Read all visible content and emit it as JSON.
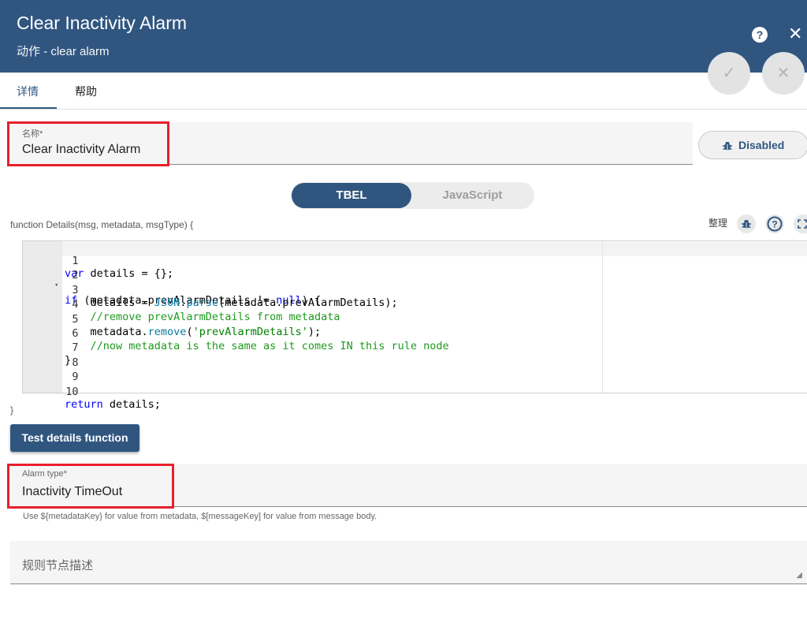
{
  "header": {
    "title": "Clear Inactivity Alarm",
    "subtitle": "动作 - clear alarm",
    "help_icon": "help-icon",
    "close_icon": "close-icon",
    "help_glyph": "?",
    "close_glyph": "✕",
    "ok_glyph": "✓",
    "cancel_glyph": "✕"
  },
  "tabs": [
    {
      "label": "详情",
      "active": true
    },
    {
      "label": "帮助",
      "active": false
    }
  ],
  "name_field": {
    "label": "名称*",
    "value": "Clear Inactivity Alarm"
  },
  "debug_button": {
    "label": "Disabled",
    "icon": "bug-icon"
  },
  "script_lang": {
    "options": [
      "TBEL",
      "JavaScript"
    ],
    "selected": "TBEL"
  },
  "editor": {
    "signature": "function Details(msg, metadata, msgType) {",
    "closing": "}",
    "tools": {
      "tidy": "整理",
      "bug_icon": "bug-icon",
      "help_icon": "help-icon",
      "fullscreen_icon": "fullscreen-icon"
    },
    "line_numbers": [
      "1",
      "2",
      "3",
      "4",
      "5",
      "6",
      "7",
      "8",
      "9",
      "10"
    ],
    "lines": [
      "var details = {};",
      "if (metadata.prevAlarmDetails != null) {",
      "    details = JSON.parse(metadata.prevAlarmDetails);",
      "    //remove prevAlarmDetails from metadata",
      "    metadata.remove('prevAlarmDetails');",
      "    //now metadata is the same as it comes IN this rule node",
      "}",
      "",
      "",
      "return details;"
    ]
  },
  "test_button": {
    "label": "Test details function"
  },
  "alarm_type": {
    "label": "Alarm type*",
    "value": "Inactivity TimeOut",
    "hint": "Use ${metadataKey} for value from metadata, $[messageKey] for value from message body."
  },
  "description": {
    "placeholder": "规则节点描述"
  },
  "colors": {
    "primary": "#305680",
    "highlight": "#e8202c"
  }
}
